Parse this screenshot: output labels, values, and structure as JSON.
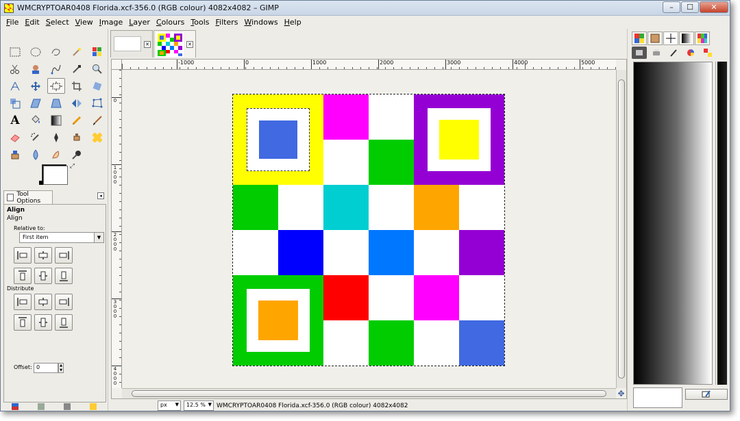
{
  "window": {
    "title": "WMCRYPTOAR0408 Florida.xcf-356.0 (RGB colour) 4082x4082 – GIMP",
    "minimize": "–",
    "maximize": "☐",
    "close": "✕"
  },
  "menu": [
    {
      "u": "F",
      "rest": "ile"
    },
    {
      "u": "E",
      "rest": "dit"
    },
    {
      "u": "S",
      "rest": "elect"
    },
    {
      "u": "V",
      "rest": "iew"
    },
    {
      "u": "I",
      "rest": "mage"
    },
    {
      "u": "L",
      "rest": "ayer"
    },
    {
      "u": "C",
      "rest": "olours"
    },
    {
      "u": "T",
      "rest": "ools"
    },
    {
      "u": "F",
      "rest": "ilters"
    },
    {
      "u": "W",
      "rest": "indows"
    },
    {
      "u": "H",
      "rest": "elp"
    }
  ],
  "tool_options": {
    "tab_label": "Tool Options",
    "title": "Align",
    "subtitle": "Align",
    "relative_to_label": "Relative to:",
    "relative_to_value": "First item",
    "distribute_label": "Distribute",
    "offset_label": "Offset:",
    "offset_value": "0"
  },
  "ruler": {
    "h_ticks": [
      {
        "label": "-1000",
        "pos": 80
      },
      {
        "label": "0",
        "pos": 178
      },
      {
        "label": "1000",
        "pos": 276
      },
      {
        "label": "2000",
        "pos": 374
      },
      {
        "label": "3000",
        "pos": 472
      },
      {
        "label": "4000",
        "pos": 570
      },
      {
        "label": "5000",
        "pos": 668
      }
    ],
    "v_ticks": [
      {
        "label": "0",
        "pos": 40
      },
      {
        "label": "1000",
        "pos": 138
      },
      {
        "label": "2000",
        "pos": 236
      },
      {
        "label": "3000",
        "pos": 334
      },
      {
        "label": "4000",
        "pos": 432
      }
    ]
  },
  "image_grid": [
    [
      "big:#ffff00:#4169e1",
      "skip",
      "#ff00ff",
      "#ffffff",
      "big:#9400d3:#ffff00",
      "skip"
    ],
    [
      "skip",
      "skip",
      "#ffffff",
      "#00cc00",
      "skip",
      "skip"
    ],
    [
      "#00cc00",
      "#ffffff",
      "#00ced1",
      "#ffffff",
      "#ffa500",
      "#ffffff"
    ],
    [
      "#ffffff",
      "#0000ff",
      "#ffffff",
      "#0077ff",
      "#ffffff",
      "#9400d3"
    ],
    [
      "big:#00cc00:#ffa500",
      "skip",
      "#ff0000",
      "#ffffff",
      "#ff00ff",
      "#ffffff"
    ],
    [
      "skip",
      "skip",
      "#ffffff",
      "#00cc00",
      "#ffffff",
      "#4169e1"
    ]
  ],
  "status": {
    "unit": "px",
    "zoom": "12.5 %",
    "text": "WMCRYPTOAR0408 Florida.xcf-356.0 (RGB colour) 4082x4082"
  },
  "colors": {
    "accent": "#3b5e9b",
    "selection": "#ffff00"
  }
}
